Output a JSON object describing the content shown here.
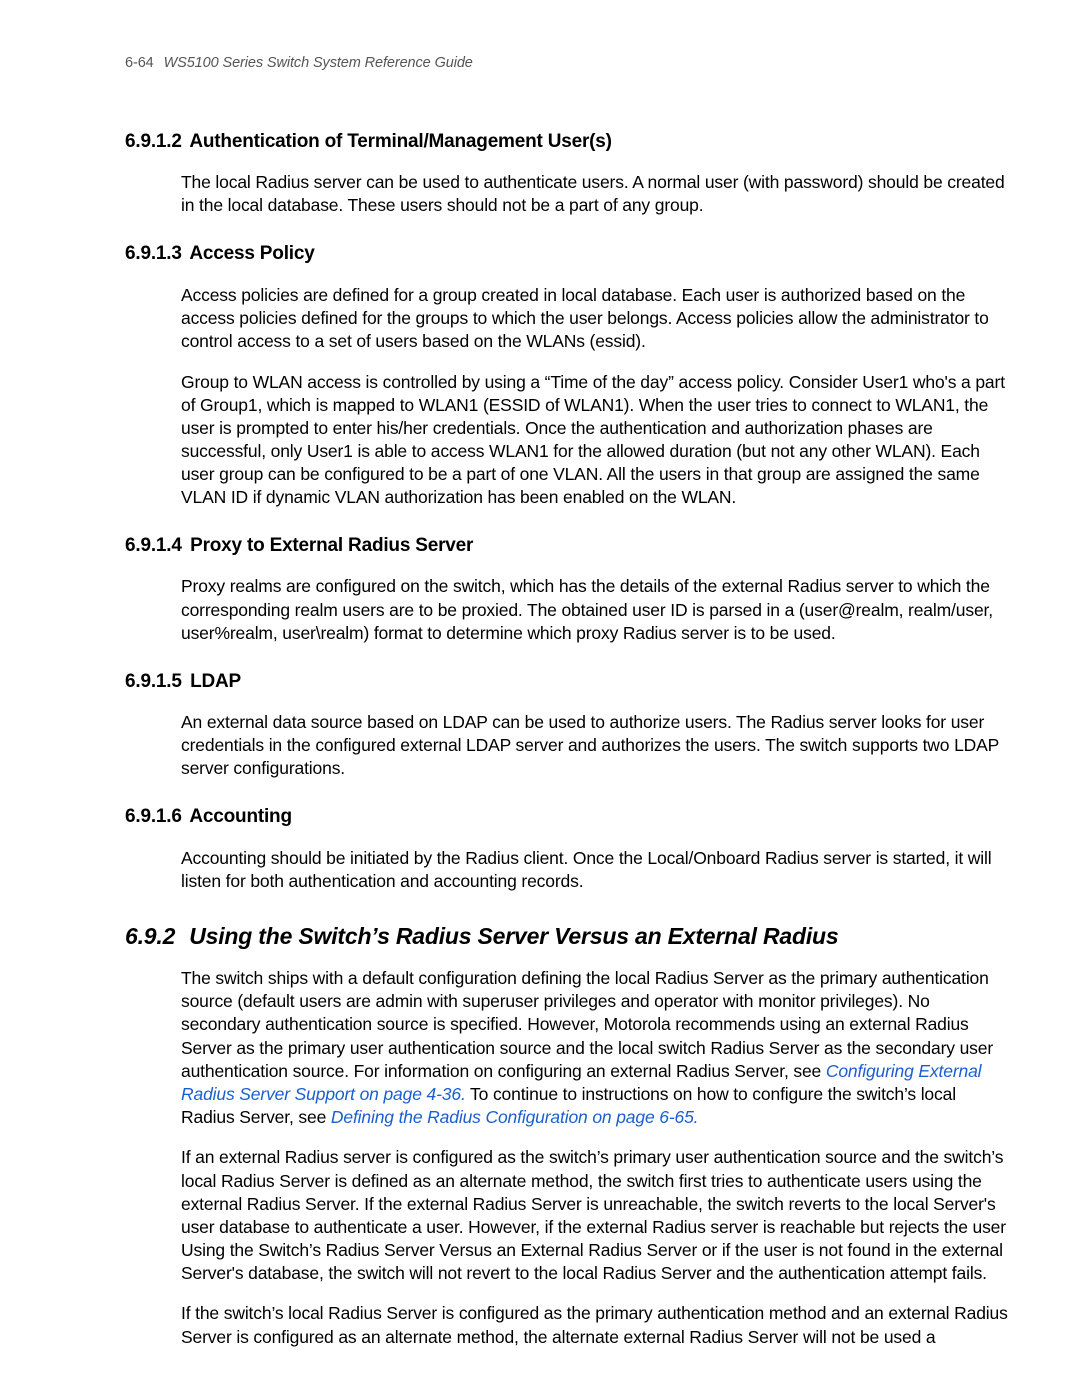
{
  "header": {
    "page_number": "6-64",
    "doc_title": "WS5100 Series Switch System Reference Guide"
  },
  "sections": {
    "s1": {
      "num": "6.9.1.2",
      "title": "Authentication of Terminal/Management User(s)",
      "p1": "The local Radius server can be used to authenticate users. A normal user (with password) should be created in the local database. These users should not be a part of any group."
    },
    "s2": {
      "num": "6.9.1.3",
      "title": "Access Policy",
      "p1": "Access policies are defined for a group created in local database. Each user is authorized based on the access policies defined for the groups to which the user belongs. Access policies allow the administrator to control access to a set of users based on the WLANs (essid).",
      "p2": "Group to WLAN access is controlled by using a “Time of the day” access policy. Consider User1 who's a part of Group1, which is mapped to WLAN1 (ESSID of WLAN1). When the user tries to connect to WLAN1, the user is prompted to enter his/her credentials. Once the authentication and authorization phases are successful, only User1 is able to access WLAN1 for the allowed duration (but not any other WLAN). Each user group can be configured to be a part of one VLAN. All the users in that group are assigned the same VLAN ID if dynamic VLAN authorization has been enabled on the WLAN."
    },
    "s3": {
      "num": "6.9.1.4",
      "title": "Proxy to External Radius Server",
      "p1": "Proxy realms are configured on the switch, which has the details of the external Radius server to which the corresponding realm users are to be proxied. The obtained user ID is parsed in a (user@realm, realm/user, user%realm, user\\realm) format to determine which proxy Radius server is to be used."
    },
    "s4": {
      "num": "6.9.1.5",
      "title": "LDAP",
      "p1": "An external data source based on LDAP can be used to authorize users. The Radius server looks for user credentials in the configured external LDAP server and authorizes the users. The switch supports two LDAP server configurations."
    },
    "s5": {
      "num": "6.9.1.6",
      "title": "Accounting",
      "p1": "Accounting should be initiated by the Radius client. Once the Local/Onboard Radius server is started, it will listen for both authentication and accounting records."
    },
    "s6": {
      "num": "6.9.2",
      "title": "Using the Switch’s Radius Server Versus an External Radius",
      "p1_a": "The switch ships with a default configuration defining the local Radius Server as the primary authentication source (default users are admin with superuser privileges and operator with monitor privileges). No secondary authentication source is specified. However, Motorola recommends using an external Radius Server as the primary user authentication source and the local switch Radius Server as the secondary user authentication source. For information on configuring an external Radius Server, see ",
      "link1": "Configuring External Radius Server Support on page 4-36.",
      "p1_b": " To continue to instructions on how to configure the switch’s local Radius Server, see ",
      "link2": "Defining the Radius Configuration on page 6-65.",
      "p2": "If an external Radius server is configured as the switch’s primary user authentication source and the switch’s local Radius Server is defined as an alternate method, the switch first tries to authenticate users using the external Radius Server. If the external Radius Server is unreachable, the switch reverts to the local Server's user database to authenticate a user. However, if the external Radius server is reachable but rejects the user Using the Switch’s Radius Server Versus an External Radius Server or if the user is not found in the external Server's database, the switch will not revert to the local Radius Server and the authentication attempt fails.",
      "p3": "If the switch’s local Radius Server is configured as the primary authentication method and an external Radius Server is configured as an alternate method, the alternate external Radius Server will not be used a"
    }
  }
}
